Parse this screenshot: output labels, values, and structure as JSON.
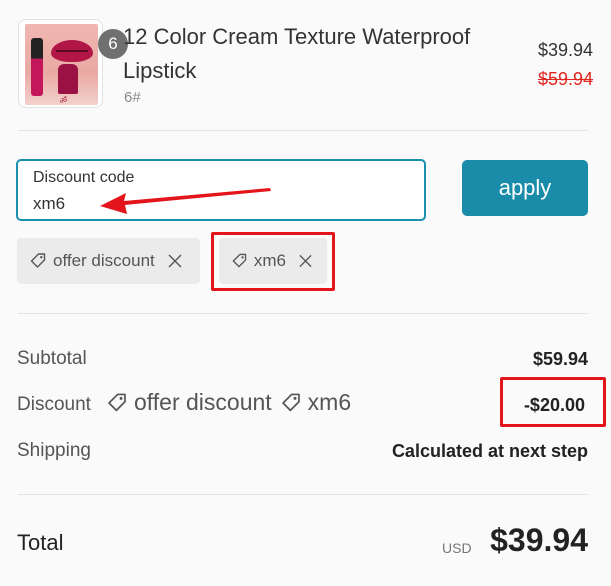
{
  "product": {
    "quantity": "6",
    "title": "12 Color Cream Texture Waterproof Lipstick",
    "variant": "6#",
    "price": "$39.94",
    "original_price": "$59.94"
  },
  "discount_form": {
    "label": "Discount code",
    "value": "xm6",
    "apply_label": "apply"
  },
  "applied_codes": [
    {
      "label": "offer discount"
    },
    {
      "label": "xm6"
    }
  ],
  "summary": {
    "subtotal_label": "Subtotal",
    "subtotal_value": "$59.94",
    "discount_label": "Discount",
    "discount_value": "-$20.00",
    "shipping_label": "Shipping",
    "shipping_value": "Calculated at next step",
    "total_label": "Total",
    "currency": "USD",
    "total_value": "$39.94"
  },
  "colors": {
    "accent": "#1a8ca9",
    "sale_red": "#e0251f",
    "annotation_red": "#e3141a"
  }
}
